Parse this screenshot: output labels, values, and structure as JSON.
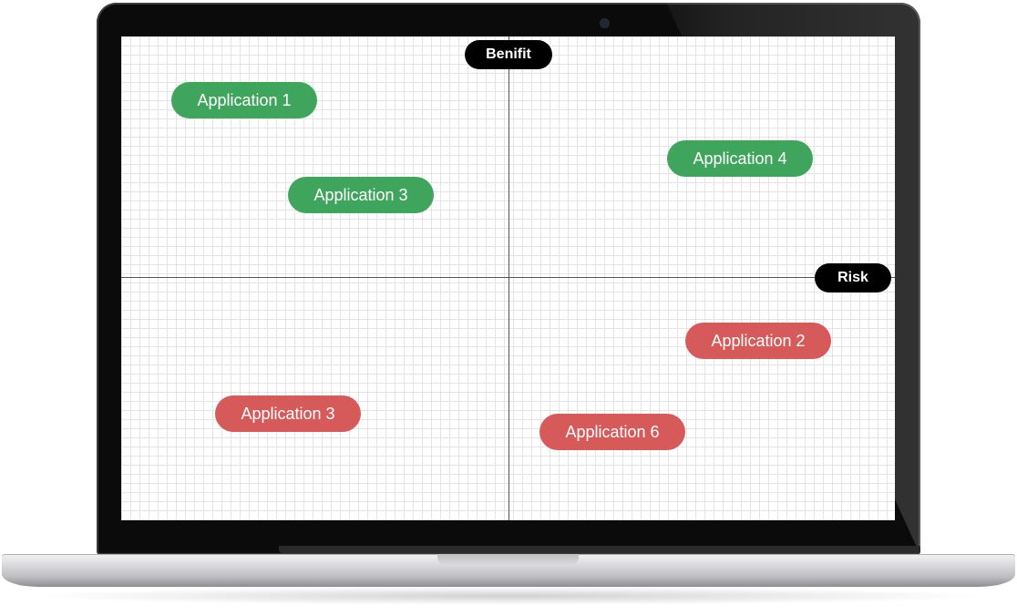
{
  "axes": {
    "y_label": "Benifit",
    "x_label": "Risk"
  },
  "colors": {
    "positive": "#3fa55d",
    "negative": "#d65a5a",
    "axis_label_bg": "#000000"
  },
  "applications": [
    {
      "label": "Application 1",
      "quadrant": "top-left",
      "status": "positive"
    },
    {
      "label": "Application 3",
      "quadrant": "top-left",
      "status": "positive"
    },
    {
      "label": "Application 4",
      "quadrant": "top-right",
      "status": "positive"
    },
    {
      "label": "Application 2",
      "quadrant": "bottom-right",
      "status": "negative"
    },
    {
      "label": "Application 3",
      "quadrant": "bottom-left",
      "status": "negative"
    },
    {
      "label": "Application 6",
      "quadrant": "bottom-right",
      "status": "negative"
    }
  ]
}
